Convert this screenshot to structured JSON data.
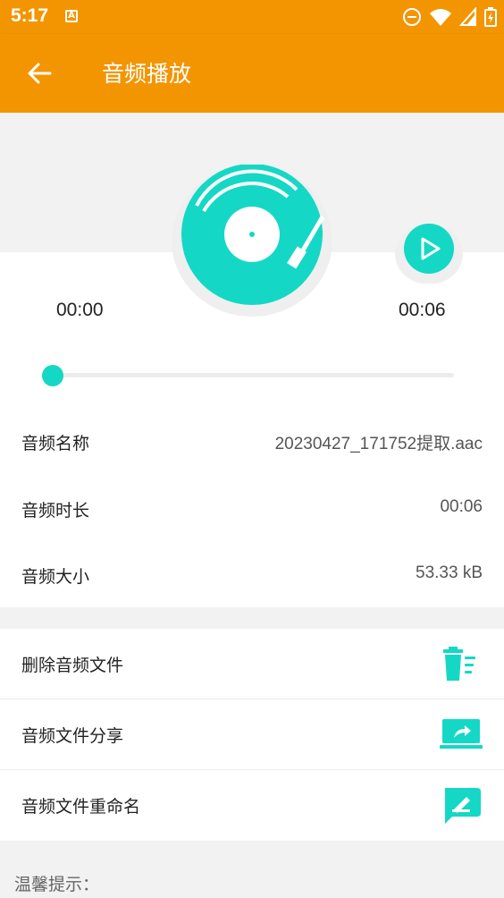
{
  "status_bar": {
    "time": "5:17",
    "notification_icon": "a-notification-icon",
    "right_icons": [
      "dnd-icon",
      "wifi-icon",
      "signal-icon",
      "battery-icon"
    ]
  },
  "app_bar": {
    "title": "音频播放",
    "back_icon": "arrow-left-icon"
  },
  "player": {
    "current_time": "00:00",
    "total_time": "00:06",
    "progress": 0,
    "play_icon": "play-icon",
    "disc_icon": "vinyl-record-icon"
  },
  "info": [
    {
      "label": "音频名称",
      "value": "20230427_171752提取.aac"
    },
    {
      "label": "音频时长",
      "value": "00:06"
    },
    {
      "label": "音频大小",
      "value": "53.33 kB"
    }
  ],
  "actions": [
    {
      "label": "删除音频文件",
      "icon": "trash-icon"
    },
    {
      "label": "音频文件分享",
      "icon": "share-icon"
    },
    {
      "label": "音频文件重命名",
      "icon": "rename-icon"
    }
  ],
  "tip": "温馨提示：",
  "colors": {
    "appbar": "#f39500",
    "accent": "#14d8c5"
  }
}
